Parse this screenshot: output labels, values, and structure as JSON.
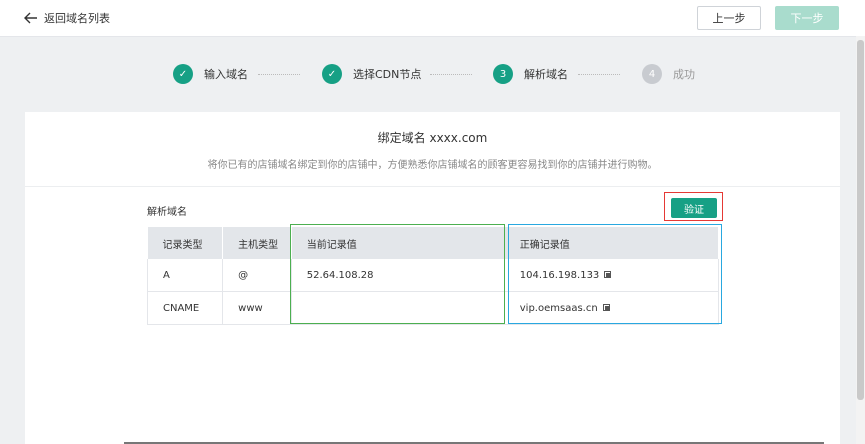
{
  "header": {
    "back_label": "返回域名列表",
    "prev_label": "上一步",
    "next_label": "下一步"
  },
  "steps": [
    {
      "label": "输入域名",
      "state": "done",
      "marker": "✓"
    },
    {
      "label": "选择CDN节点",
      "state": "done",
      "marker": "✓"
    },
    {
      "label": "解析域名",
      "state": "active",
      "marker": "3"
    },
    {
      "label": "成功",
      "state": "todo",
      "marker": "4"
    }
  ],
  "card": {
    "title": "绑定域名 xxxx.com",
    "subtitle": "将你已有的店铺域名绑定到你的店铺中，方便熟悉你店铺域名的顾客更容易找到你的店铺并进行购物。",
    "section_label": "解析域名",
    "verify_label": "验证"
  },
  "table": {
    "headers": [
      "记录类型",
      "主机类型",
      "当前记录值",
      "正确记录值"
    ],
    "rows": [
      [
        "A",
        "@",
        "52.64.108.28",
        "104.16.198.133"
      ],
      [
        "CNAME",
        "www",
        "",
        "vip.oemsaas.cn"
      ]
    ]
  },
  "colors": {
    "accent": "#16a085",
    "accent_disabled": "#a9dccd",
    "highlight_red": "#e53935",
    "highlight_green": "#4caf50",
    "highlight_blue": "#29a8e0"
  },
  "icons": {
    "back": "arrow-left-icon",
    "copy": "copy-icon",
    "check": "check-icon"
  }
}
